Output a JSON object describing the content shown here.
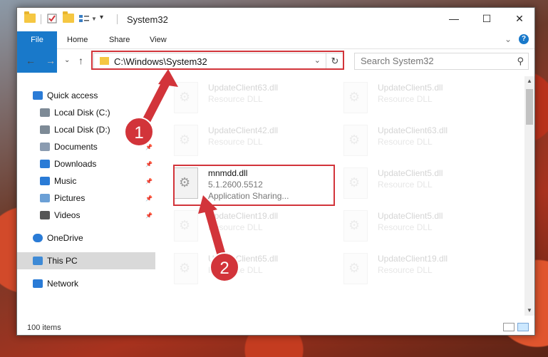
{
  "window": {
    "title": "System32",
    "minimize": "—",
    "maximize": "☐",
    "close": "✕"
  },
  "ribbon": {
    "tabs": [
      "File",
      "Home",
      "Share",
      "View"
    ],
    "expand": "⌄",
    "help": "?"
  },
  "address": {
    "path": "C:\\Windows\\System32",
    "refresh": "↻",
    "dropdown": "⌄",
    "back": "←",
    "forward": "→",
    "recent": "⌄",
    "up": "↑"
  },
  "search": {
    "placeholder": "Search System32",
    "icon": "⚲"
  },
  "nav": [
    {
      "label": "Quick access",
      "icon": "star-icon",
      "pin": false
    },
    {
      "label": "Local Disk (C:)",
      "icon": "drive-icon",
      "pin": true
    },
    {
      "label": "Local Disk (D:)",
      "icon": "drive-icon",
      "pin": true
    },
    {
      "label": "Documents",
      "icon": "documents-icon",
      "pin": true
    },
    {
      "label": "Downloads",
      "icon": "downloads-icon",
      "pin": true
    },
    {
      "label": "Music",
      "icon": "music-icon",
      "pin": true
    },
    {
      "label": "Pictures",
      "icon": "pictures-icon",
      "pin": true
    },
    {
      "label": "Videos",
      "icon": "videos-icon",
      "pin": true
    },
    {
      "label": "OneDrive",
      "icon": "cloud-icon",
      "pin": false
    },
    {
      "label": "This PC",
      "icon": "computer-icon",
      "pin": false,
      "selected": true
    },
    {
      "label": "Network",
      "icon": "network-icon",
      "pin": false
    }
  ],
  "files": [
    {
      "name": "UpdateClient63.dll",
      "desc": "Resource DLL"
    },
    {
      "name": "UpdateClient5.dll",
      "desc": "Resource DLL"
    },
    {
      "name": "UpdateClient42.dll",
      "desc": "Resource DLL"
    },
    {
      "name": "UpdateClient63.dll",
      "desc": "Resource DLL"
    },
    {
      "name": "mnmdd.dll",
      "desc": "5.1.2600.5512",
      "desc2": "Application Sharing...",
      "highlighted": true
    },
    {
      "name": "UpdateClient5.dll",
      "desc": "Resource DLL"
    },
    {
      "name": "UpdateClient19.dll",
      "desc": "Resource DLL"
    },
    {
      "name": "UpdateClient5.dll",
      "desc": "Resource DLL"
    },
    {
      "name": "UpdateClient65.dll",
      "desc": "Resource DLL"
    },
    {
      "name": "UpdateClient19.dll",
      "desc": "Resource DLL"
    }
  ],
  "status": {
    "count": "100 items"
  },
  "callouts": [
    "1",
    "2"
  ],
  "colors": {
    "accent": "#1979ca",
    "highlight": "#d2343a"
  }
}
